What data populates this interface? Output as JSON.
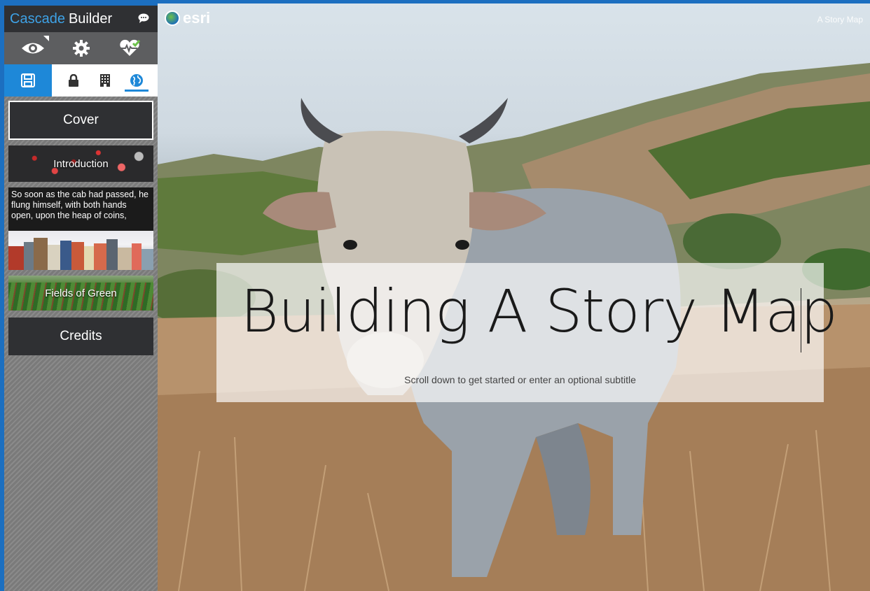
{
  "builder": {
    "title_brand": "Cascade",
    "title_rest": "Builder",
    "tool_row1_icons": [
      "eye-icon",
      "gear-icon",
      "heartbeat-check-icon"
    ],
    "save_icon": "floppy-disk-icon",
    "permission_icons": [
      "lock-icon",
      "building-icon",
      "globe-icon"
    ],
    "active_permission": "globe-icon",
    "sections": [
      {
        "label": "Cover",
        "kind": "cover",
        "selected": true
      },
      {
        "label": "Introduction",
        "kind": "image"
      },
      {
        "label": "So soon as the cab had passed, he flung himself, with both hands open, upon the heap of coins,",
        "kind": "text-image"
      },
      {
        "label": "Fields of Green",
        "kind": "image"
      },
      {
        "label": "Credits",
        "kind": "credits"
      }
    ],
    "accent_color": "#1e88d8",
    "brand_color": "#3ea2e6"
  },
  "stage": {
    "logo_text": "esri",
    "story_label": "A Story Map",
    "title": "Building A Story Map",
    "subtitle": "Scroll down to get started or enter an optional subtitle"
  }
}
